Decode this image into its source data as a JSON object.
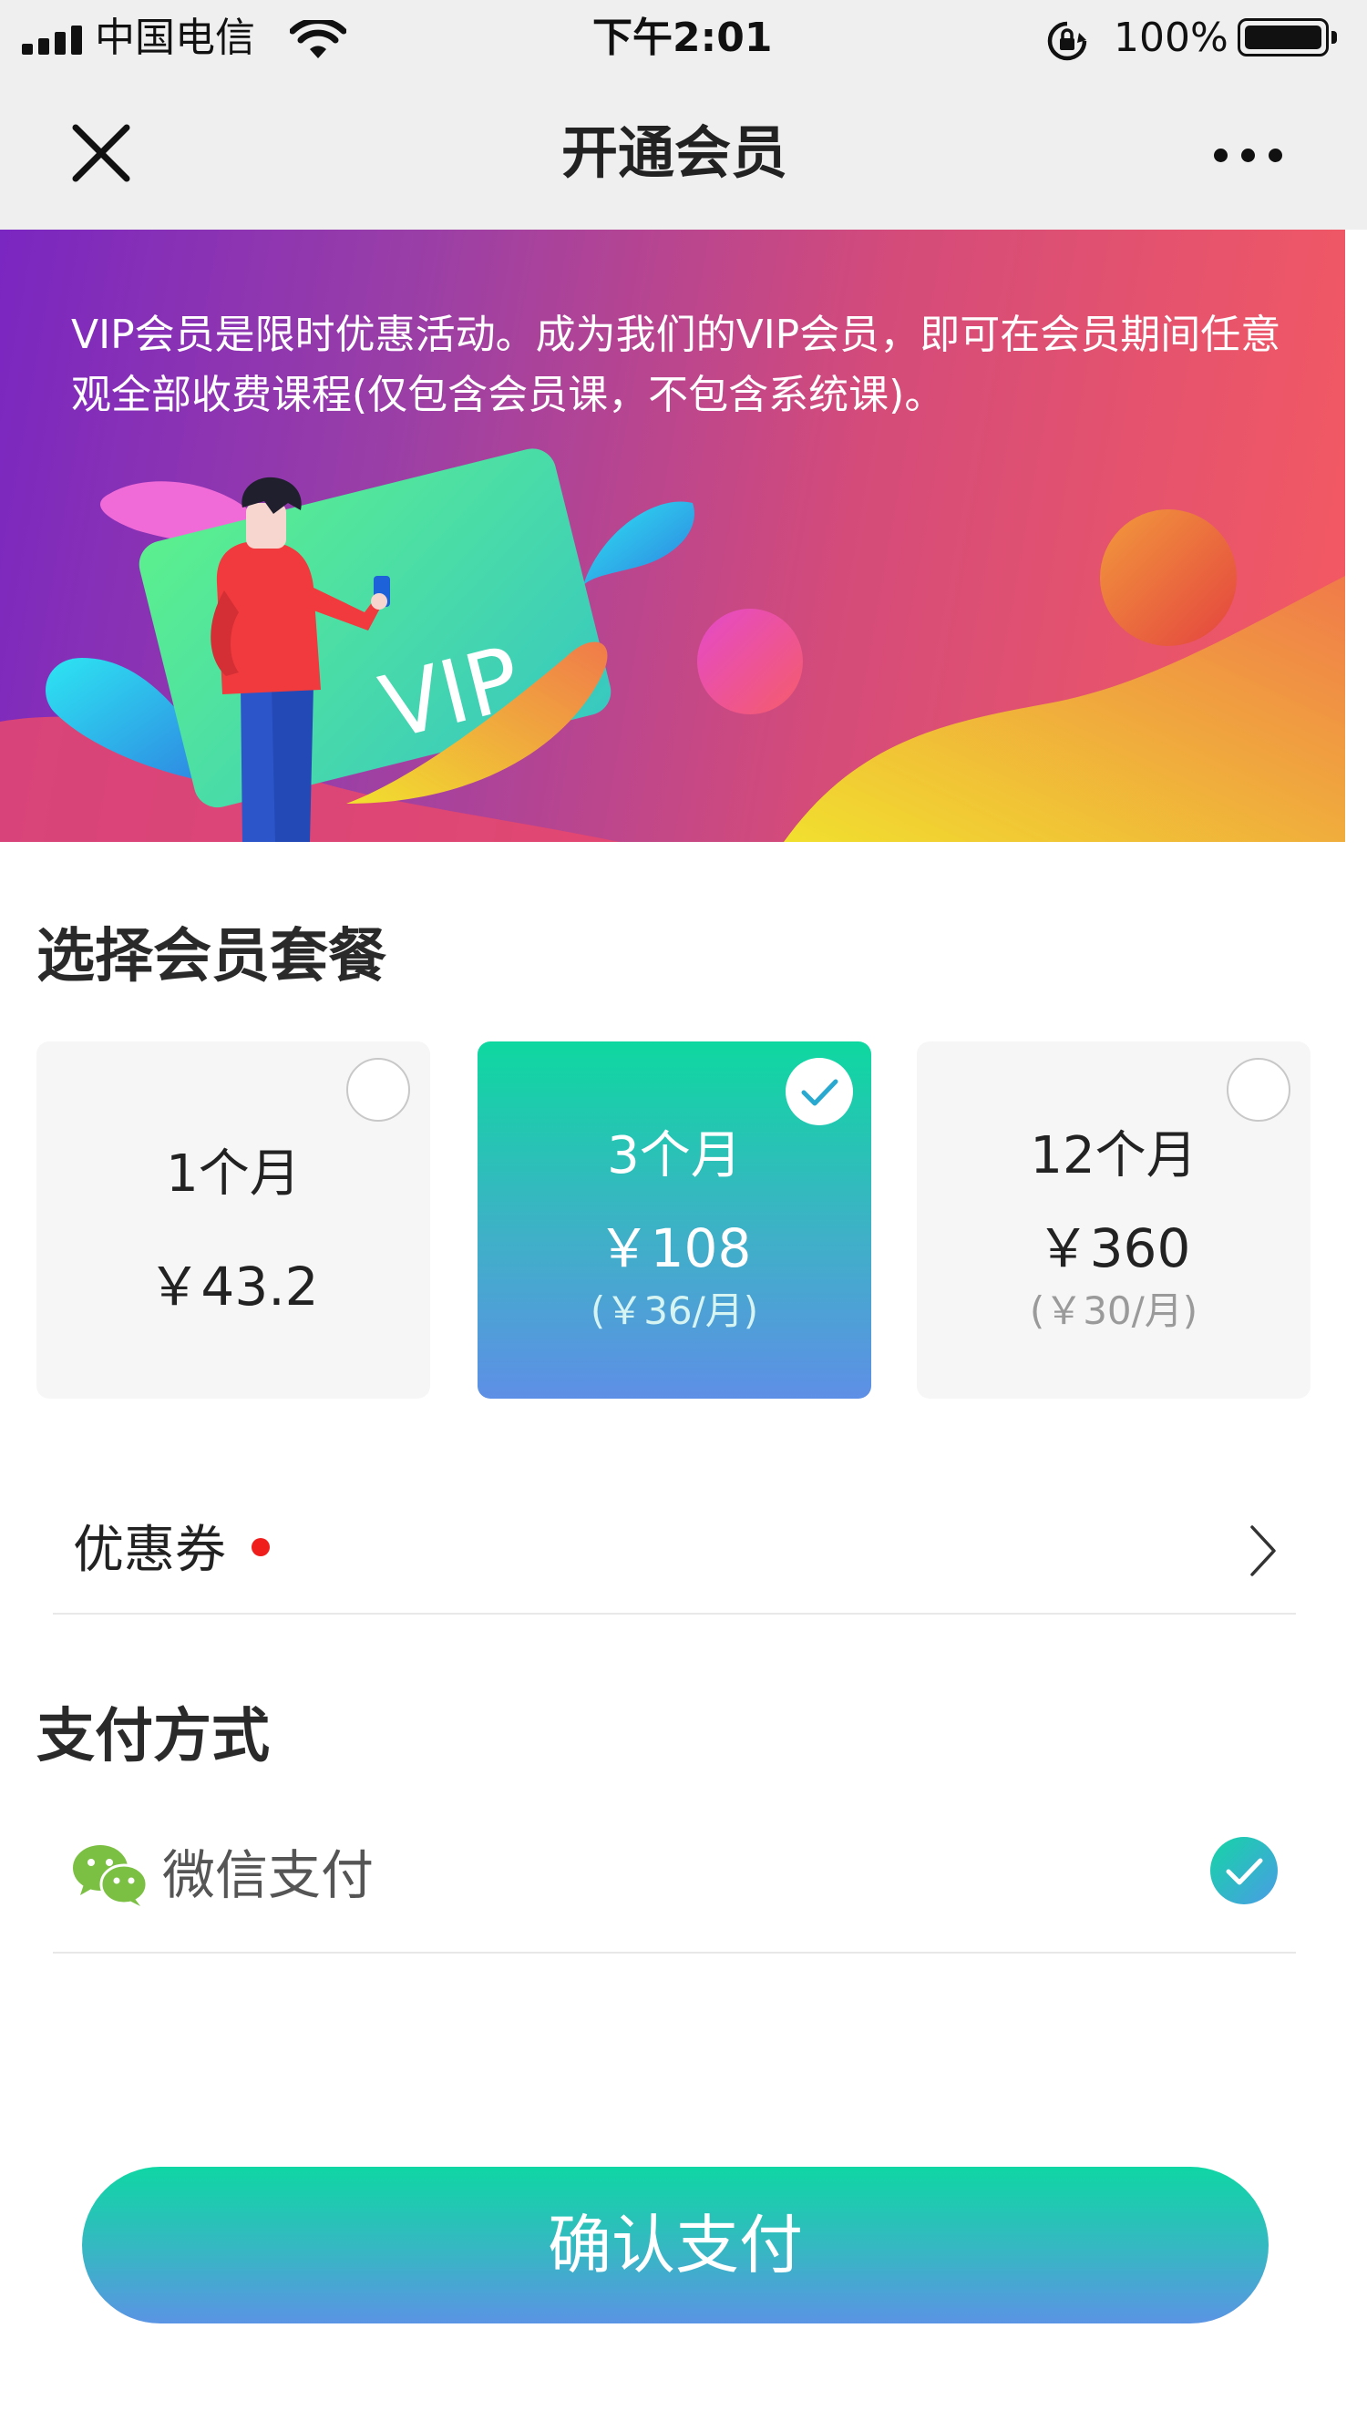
{
  "status_bar": {
    "carrier": "中国电信",
    "time": "下午2:01",
    "battery": "100%"
  },
  "nav": {
    "title": "开通会员"
  },
  "banner": {
    "description": "VIP会员是限时优惠活动。成为我们的VIP会员，即可在会员期间任意观全部收费课程(仅包含会员课，不包含系统课)。",
    "card_text": "VIP"
  },
  "plans": {
    "title": "选择会员套餐",
    "items": [
      {
        "duration": "1个月",
        "price": "￥43.2",
        "monthly": "",
        "selected": false
      },
      {
        "duration": "3个月",
        "price": "￥108",
        "monthly": "(￥36/月)",
        "selected": true
      },
      {
        "duration": "12个月",
        "price": "￥360",
        "monthly": "(￥30/月)",
        "selected": false
      }
    ]
  },
  "coupon": {
    "label": "优惠券"
  },
  "payment": {
    "title": "支付方式",
    "method": "微信支付"
  },
  "confirm": {
    "label": "确认支付"
  },
  "colors": {
    "accent_start": "#0ed8a0",
    "accent_end": "#5e8fe6",
    "banner_start": "#7a26c1",
    "banner_end": "#f55a61",
    "badge_dot": "#f01d1d",
    "wechat_green": "#7bc043"
  }
}
